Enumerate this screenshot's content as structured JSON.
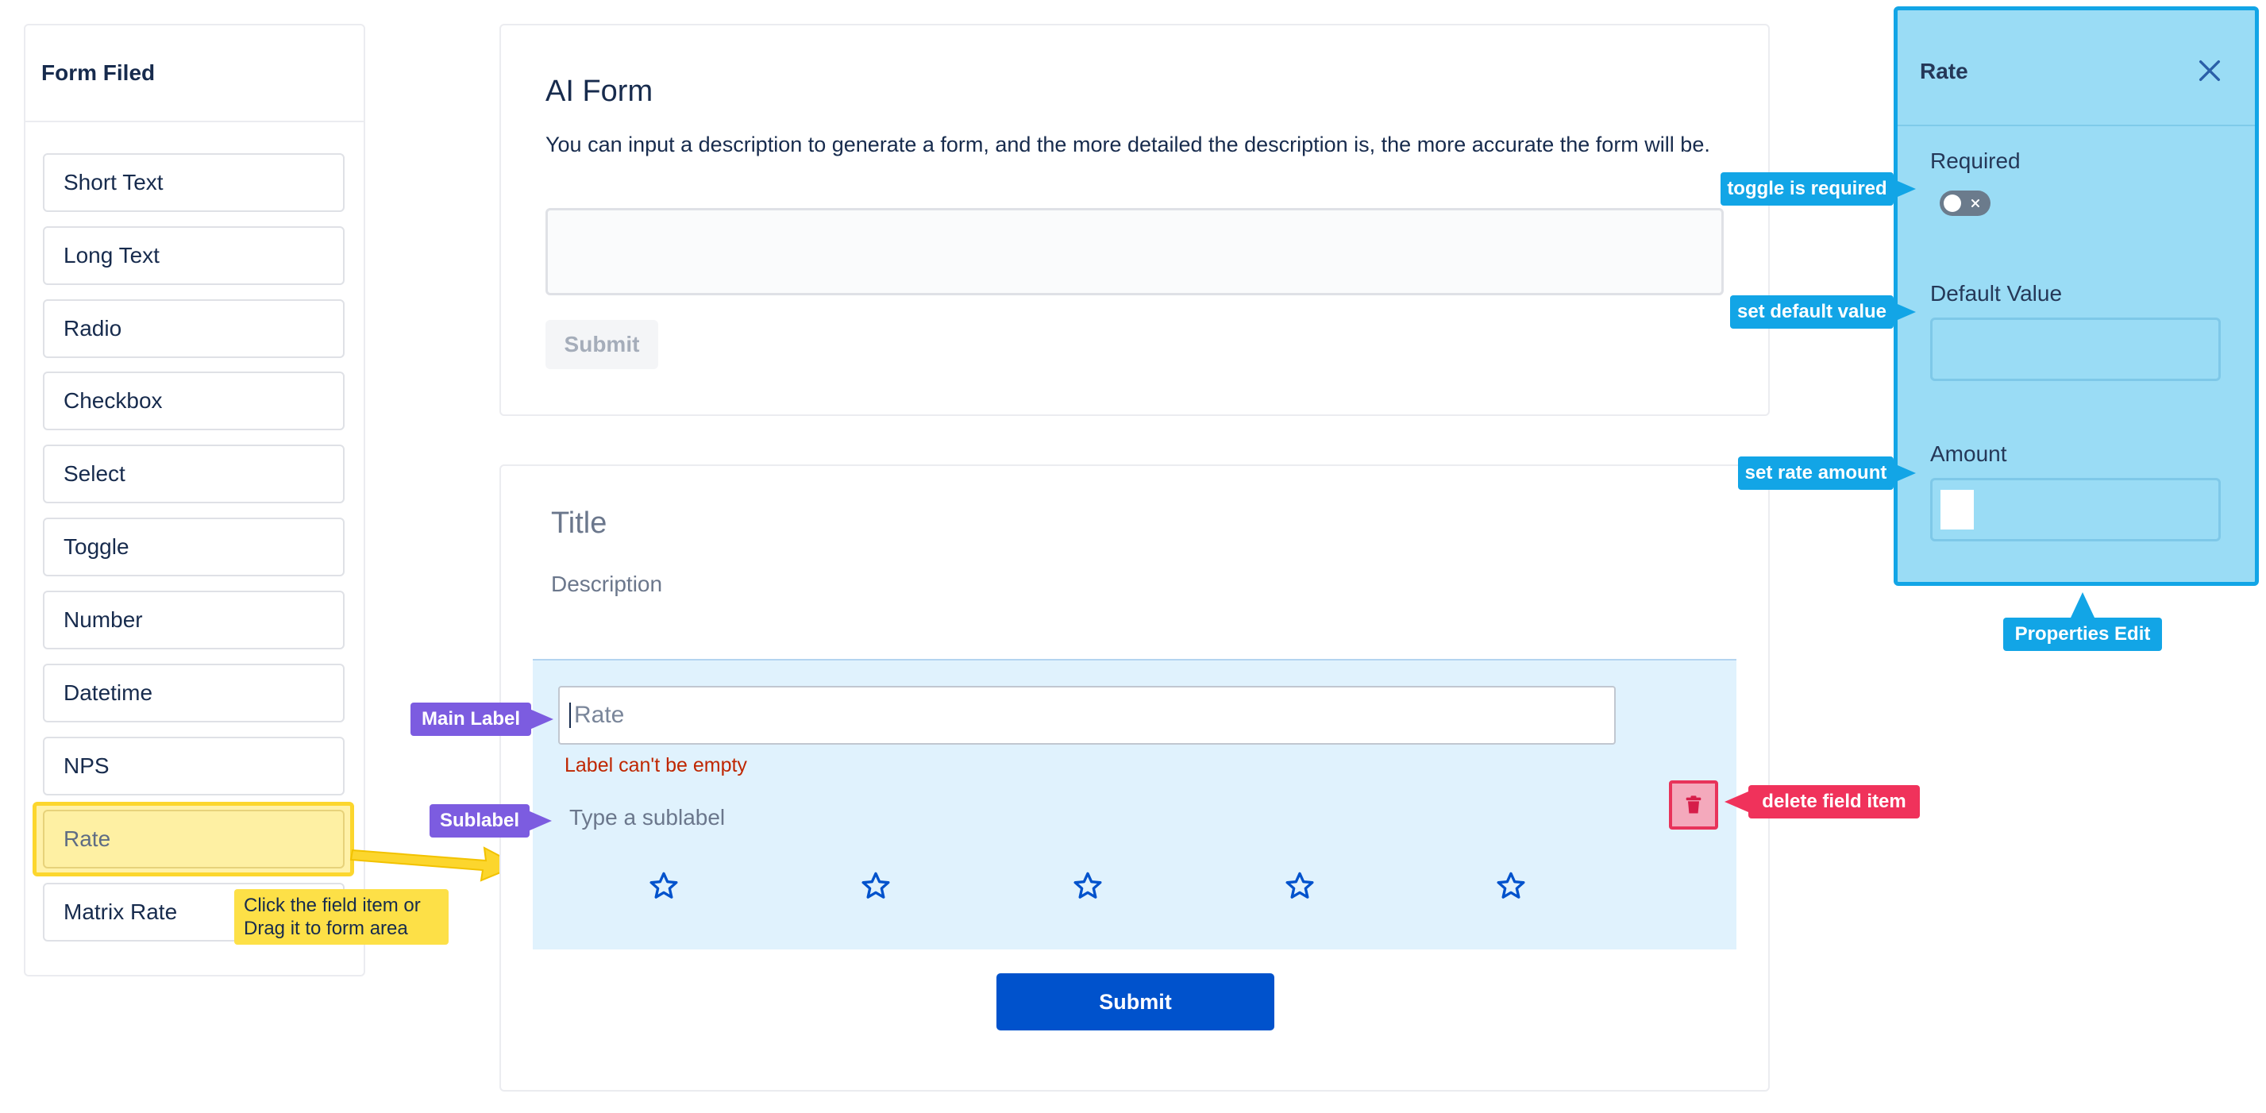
{
  "palette": {
    "title": "Form Filed",
    "items": [
      "Short Text",
      "Long Text",
      "Radio",
      "Checkbox",
      "Select",
      "Toggle",
      "Number",
      "Datetime",
      "NPS",
      "Rate",
      "Matrix Rate"
    ]
  },
  "ai_form": {
    "title": "AI Form",
    "description": "You can input a description to generate a form, and the more detailed the description is, the more accurate the form will be.",
    "input_value": "",
    "submit_label": "Submit"
  },
  "form": {
    "title": "Title",
    "description": "Description",
    "field": {
      "label_value": "Rate",
      "error": "Label can't be empty",
      "sublabel_placeholder": "Type a sublabel",
      "star_count": 5
    },
    "submit_label": "Submit"
  },
  "properties": {
    "title": "Rate",
    "required_label": "Required",
    "required_value": false,
    "default_value_label": "Default Value",
    "default_value": "",
    "amount_label": "Amount",
    "amount_value": ""
  },
  "annotations": {
    "toggle_required": "toggle is required",
    "set_default": "set default value",
    "set_rate_amount": "set rate amount",
    "properties_edit": "Properties Edit",
    "main_label": "Main Label",
    "sublabel": "Sublabel",
    "delete_field": "delete field item",
    "click_drag": "Click the field item or Drag it to form area"
  },
  "colors": {
    "primary": "#0052cc",
    "annotation_blue": "#12a5e6",
    "annotation_purple": "#7c5ce0",
    "annotation_red": "#f0325b",
    "annotation_yellow": "#fde047",
    "error": "#bf2600"
  },
  "icons": [
    "close-icon",
    "star-icon",
    "trash-icon",
    "toggle-x-icon"
  ]
}
